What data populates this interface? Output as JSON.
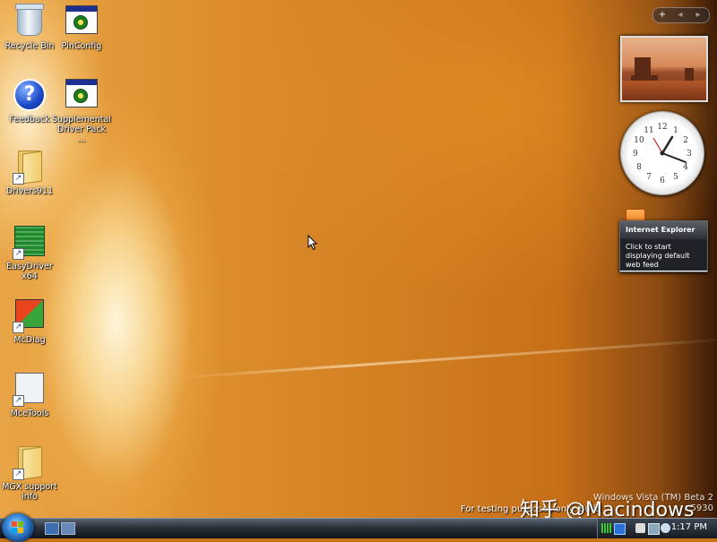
{
  "desktop_icons": [
    {
      "label": "Recycle Bin",
      "icon": "recycle-bin-icon"
    },
    {
      "label": "PinConfig",
      "icon": "app-window-icon"
    },
    {
      "label": "Feedback",
      "icon": "help-icon"
    },
    {
      "label": "Supplemental Driver Pack ...",
      "icon": "app-window-icon"
    },
    {
      "label": "Drivers911",
      "icon": "folder-icon"
    },
    {
      "label": "EasyDriver x64",
      "icon": "circuit-board-icon"
    },
    {
      "label": "McDiag",
      "icon": "diagnostic-icon"
    },
    {
      "label": "MceTools",
      "icon": "document-icon"
    },
    {
      "label": "MGX support info",
      "icon": "folder-icon"
    }
  ],
  "sidebar": {
    "controls": {
      "add": "+",
      "prev": "◂",
      "next": "▸"
    },
    "feed": {
      "title": "Internet Explorer",
      "message": "Click to start displaying default web feed"
    },
    "clock_numbers": [
      "12",
      "1",
      "2",
      "3",
      "4",
      "5",
      "6",
      "7",
      "8",
      "9",
      "10",
      "11"
    ]
  },
  "watermark": {
    "line1": "Windows Vista (TM) Beta 2",
    "line2_visible": "5930",
    "testing": "For testing purposes only. Build"
  },
  "overlay_text": "知乎 @Macindows",
  "taskbar": {
    "time": "1:17 PM",
    "quick_launch": [
      "show-desktop-icon",
      "switch-windows-icon"
    ]
  },
  "colors": {
    "wallpaper": "#d27f22",
    "taskbar": "#1b222a",
    "accent": "#3d8ee0"
  }
}
